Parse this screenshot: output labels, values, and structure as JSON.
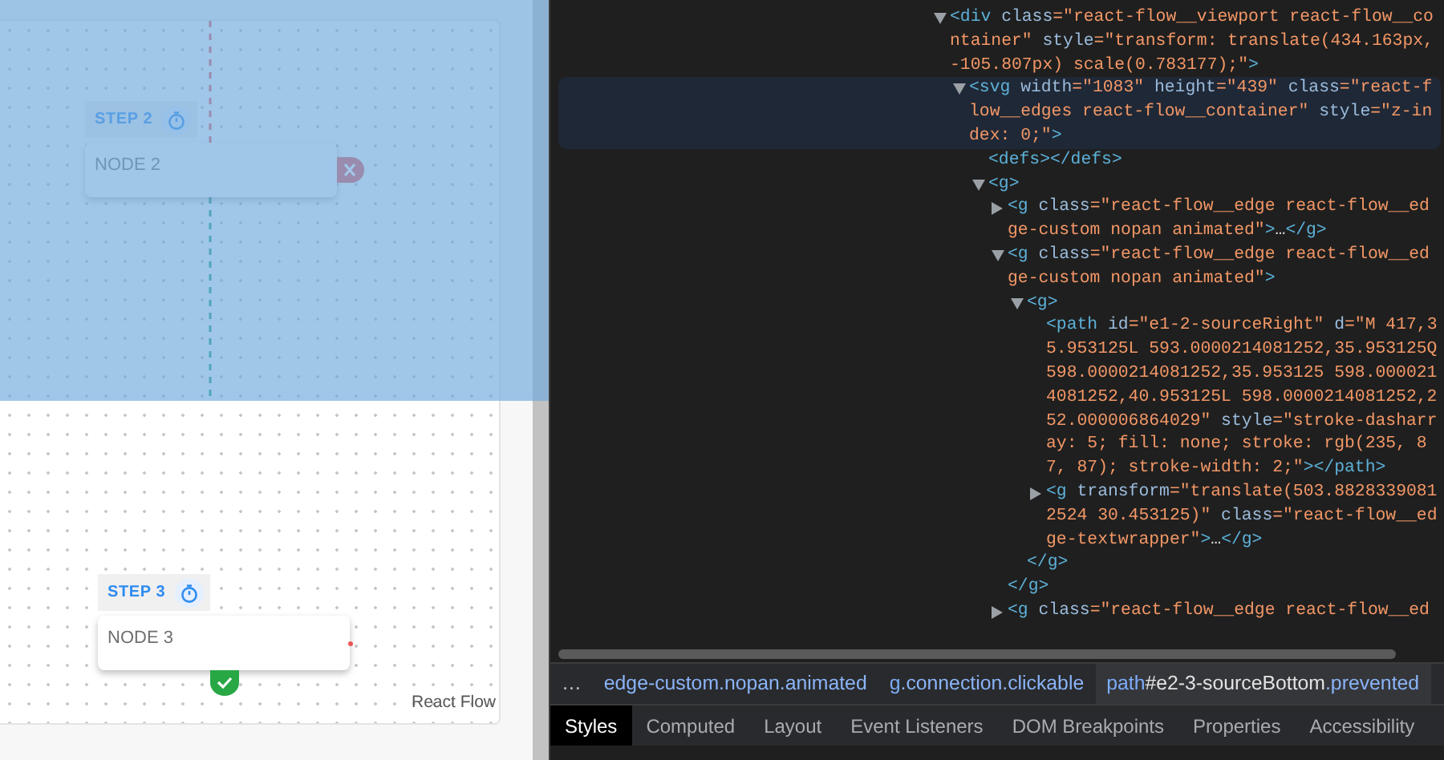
{
  "canvas": {
    "inspected_highlight": true,
    "nodes": [
      {
        "step": "STEP 2",
        "label": "NODE 2",
        "kind": "error"
      },
      {
        "step": "STEP 3",
        "label": "NODE 3",
        "kind": "success"
      }
    ],
    "attribution": "React Flow"
  },
  "devtools": {
    "tree": [
      {
        "kind": "node",
        "expanded": true,
        "selected": false,
        "lines": [
          [
            {
              "kind": "tag",
              "text": "<div"
            },
            {
              "kind": "attr",
              "text": " class"
            },
            {
              "kind": "val",
              "text": "=\"react-flow__viewport react-flow__co"
            }
          ],
          [
            {
              "kind": "val",
              "text": "ntainer\""
            },
            {
              "kind": "attr",
              "text": " style"
            },
            {
              "kind": "val",
              "text": "=\"transform: translate(434.163px,"
            }
          ],
          [
            {
              "kind": "val",
              "text": "-105.807px) scale(0.783177);\""
            },
            {
              "kind": "tag",
              "text": ">"
            }
          ]
        ],
        "children": [
          {
            "kind": "node",
            "expanded": true,
            "selected": true,
            "lines": [
              [
                {
                  "kind": "tag",
                  "text": "<svg"
                },
                {
                  "kind": "attr",
                  "text": " width"
                },
                {
                  "kind": "val",
                  "text": "=\"1083\""
                },
                {
                  "kind": "attr",
                  "text": " height"
                },
                {
                  "kind": "val",
                  "text": "=\"439\""
                },
                {
                  "kind": "attr",
                  "text": " class"
                },
                {
                  "kind": "val",
                  "text": "=\"react-f"
                }
              ],
              [
                {
                  "kind": "val",
                  "text": "low__edges react-flow__container\""
                },
                {
                  "kind": "attr",
                  "text": " style"
                },
                {
                  "kind": "val",
                  "text": "=\"z-in"
                }
              ],
              [
                {
                  "kind": "val",
                  "text": "dex: 0;\""
                },
                {
                  "kind": "tag",
                  "text": ">"
                }
              ]
            ],
            "children": [
              {
                "kind": "leaf",
                "selected": false,
                "lines": [
                  [
                    {
                      "kind": "tag",
                      "text": "<defs></defs>"
                    }
                  ]
                ]
              },
              {
                "kind": "node",
                "expanded": true,
                "selected": false,
                "lines": [
                  [
                    {
                      "kind": "tag",
                      "text": "<g>"
                    }
                  ]
                ],
                "children": [
                  {
                    "kind": "node",
                    "expanded": false,
                    "selected": false,
                    "lines": [
                      [
                        {
                          "kind": "tag",
                          "text": "<g"
                        },
                        {
                          "kind": "attr",
                          "text": " class"
                        },
                        {
                          "kind": "val",
                          "text": "=\"react-flow__edge react-flow__ed"
                        }
                      ],
                      [
                        {
                          "kind": "val",
                          "text": "ge-custom nopan animated\""
                        },
                        {
                          "kind": "tag",
                          "text": ">"
                        },
                        {
                          "kind": "text",
                          "text": "…"
                        },
                        {
                          "kind": "tag",
                          "text": "</g>"
                        }
                      ]
                    ]
                  },
                  {
                    "kind": "node",
                    "expanded": true,
                    "selected": false,
                    "lines": [
                      [
                        {
                          "kind": "tag",
                          "text": "<g"
                        },
                        {
                          "kind": "attr",
                          "text": " class"
                        },
                        {
                          "kind": "val",
                          "text": "=\"react-flow__edge react-flow__ed"
                        }
                      ],
                      [
                        {
                          "kind": "val",
                          "text": "ge-custom nopan animated\""
                        },
                        {
                          "kind": "tag",
                          "text": ">"
                        }
                      ]
                    ],
                    "closing": "</g>",
                    "children": [
                      {
                        "kind": "node",
                        "expanded": true,
                        "selected": false,
                        "lines": [
                          [
                            {
                              "kind": "tag",
                              "text": "<g>"
                            }
                          ]
                        ],
                        "closing": "</g>",
                        "children": [
                          {
                            "kind": "leaf",
                            "selected": false,
                            "lines": [
                              [
                                {
                                  "kind": "tag",
                                  "text": "<path"
                                },
                                {
                                  "kind": "attr",
                                  "text": " id"
                                },
                                {
                                  "kind": "val",
                                  "text": "=\"e1-2-sourceRight\""
                                },
                                {
                                  "kind": "attr",
                                  "text": " d"
                                },
                                {
                                  "kind": "val",
                                  "text": "=\"M 417,3"
                                }
                              ],
                              [
                                {
                                  "kind": "val",
                                  "text": "5.953125L 593.0000214081252,35.953125Q"
                                }
                              ],
                              [
                                {
                                  "kind": "val",
                                  "text": "598.0000214081252,35.953125 598.000021"
                                }
                              ],
                              [
                                {
                                  "kind": "val",
                                  "text": "4081252,40.953125L 598.0000214081252,2"
                                }
                              ],
                              [
                                {
                                  "kind": "val",
                                  "text": "52.000006864029\""
                                },
                                {
                                  "kind": "attr",
                                  "text": " style"
                                },
                                {
                                  "kind": "val",
                                  "text": "=\"stroke-dasharr"
                                }
                              ],
                              [
                                {
                                  "kind": "val",
                                  "text": "ay: 5; fill: none; stroke: rgb(235, 8"
                                }
                              ],
                              [
                                {
                                  "kind": "val",
                                  "text": "7, 87); stroke-width: 2;\""
                                },
                                {
                                  "kind": "tag",
                                  "text": "></path>"
                                }
                              ]
                            ]
                          },
                          {
                            "kind": "node",
                            "expanded": false,
                            "selected": false,
                            "lines": [
                              [
                                {
                                  "kind": "tag",
                                  "text": "<g"
                                },
                                {
                                  "kind": "attr",
                                  "text": " transform"
                                },
                                {
                                  "kind": "val",
                                  "text": "=\"translate(503.8828339081"
                                }
                              ],
                              [
                                {
                                  "kind": "val",
                                  "text": "2524 30.453125)\""
                                },
                                {
                                  "kind": "attr",
                                  "text": " class"
                                },
                                {
                                  "kind": "val",
                                  "text": "=\"react-flow__ed"
                                }
                              ],
                              [
                                {
                                  "kind": "val",
                                  "text": "ge-textwrapper\""
                                },
                                {
                                  "kind": "tag",
                                  "text": ">"
                                },
                                {
                                  "kind": "text",
                                  "text": "…"
                                },
                                {
                                  "kind": "tag",
                                  "text": "</g>"
                                }
                              ]
                            ]
                          }
                        ]
                      }
                    ]
                  },
                  {
                    "kind": "node",
                    "expanded": false,
                    "selected": false,
                    "lines": [
                      [
                        {
                          "kind": "tag",
                          "text": "<g"
                        },
                        {
                          "kind": "attr",
                          "text": " class"
                        },
                        {
                          "kind": "val",
                          "text": "=\"react-flow__edge react-flow__ed"
                        }
                      ]
                    ]
                  }
                ]
              }
            ]
          }
        ]
      }
    ],
    "breadcrumbs": [
      {
        "selected": false,
        "parts": [
          {
            "kind": "more",
            "text": "…"
          }
        ]
      },
      {
        "selected": false,
        "parts": [
          {
            "kind": "cls",
            "text": "edge-custom.nopan.animated"
          }
        ]
      },
      {
        "selected": false,
        "parts": [
          {
            "kind": "tag",
            "text": "g"
          },
          {
            "kind": "cls",
            "text": ".connection.clickable"
          }
        ]
      },
      {
        "selected": true,
        "parts": [
          {
            "kind": "tag",
            "text": "path"
          },
          {
            "kind": "id",
            "text": "#e2-3-sourceBottom"
          },
          {
            "kind": "cls",
            "text": ".prevented"
          }
        ]
      }
    ],
    "tabs": [
      {
        "label": "Styles",
        "selected": true
      },
      {
        "label": "Computed",
        "selected": false
      },
      {
        "label": "Layout",
        "selected": false
      },
      {
        "label": "Event Listeners",
        "selected": false
      },
      {
        "label": "DOM Breakpoints",
        "selected": false
      },
      {
        "label": "Properties",
        "selected": false
      },
      {
        "label": "Accessibility",
        "selected": false
      }
    ]
  }
}
